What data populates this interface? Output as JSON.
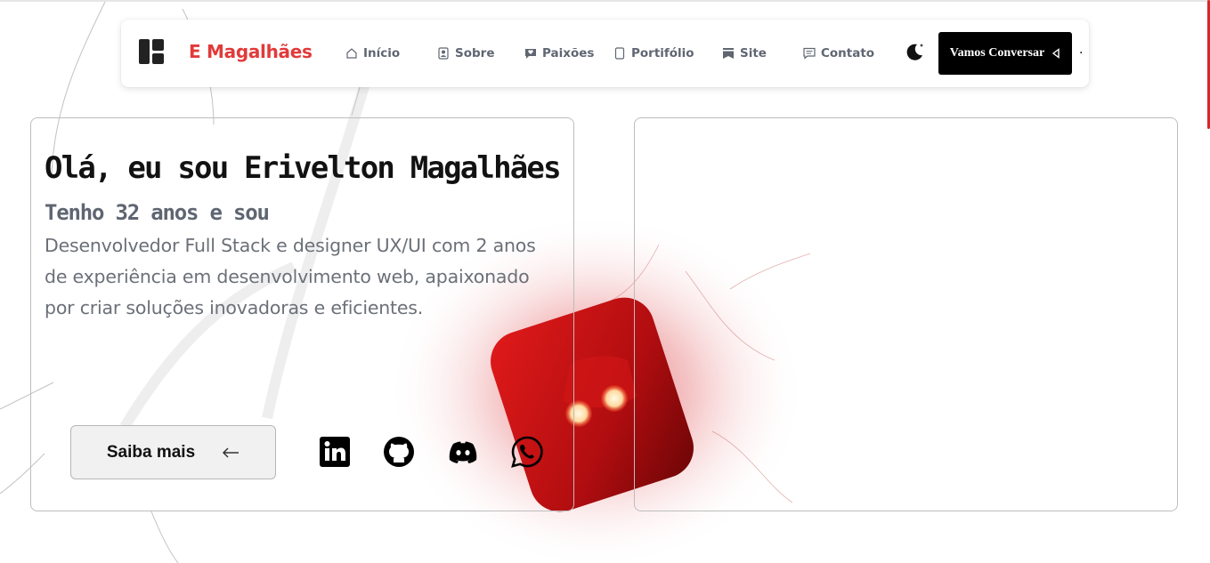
{
  "brand": {
    "name": "E Magalhães",
    "accent": "#e23a3a"
  },
  "nav": {
    "items": [
      {
        "label": "Início",
        "icon": "home-icon"
      },
      {
        "label": "Sobre",
        "icon": "profile-icon"
      },
      {
        "label": "Paixões",
        "icon": "heart-bubble-icon"
      },
      {
        "label": "Portifólio",
        "icon": "document-icon"
      },
      {
        "label": "Site",
        "icon": "bookmark-icon"
      },
      {
        "label": "Contato",
        "icon": "message-icon"
      }
    ],
    "theme_icon": "moon-icon",
    "cta_label": "Vamos Conversar",
    "cta_icon": "arrow-left-icon",
    "trailing_text": "."
  },
  "hero": {
    "title": "Olá, eu sou Erivelton Magalhães",
    "subtitle": "Tenho 32 anos e sou",
    "description": "Desenvolvedor Full Stack e designer UX/UI com 2 anos de experiência em desenvolvimento web, apaixonado por criar soluções inovadoras e eficientes.",
    "button_label": "Saiba mais",
    "button_icon": "arrow-left-icon"
  },
  "social": [
    "linkedin-icon",
    "github-icon",
    "discord-icon",
    "whatsapp-icon"
  ],
  "colors": {
    "black": "#000000",
    "muted": "#5f6672",
    "card_border": "#bdbdbd",
    "glow_red": "#d6161b"
  }
}
